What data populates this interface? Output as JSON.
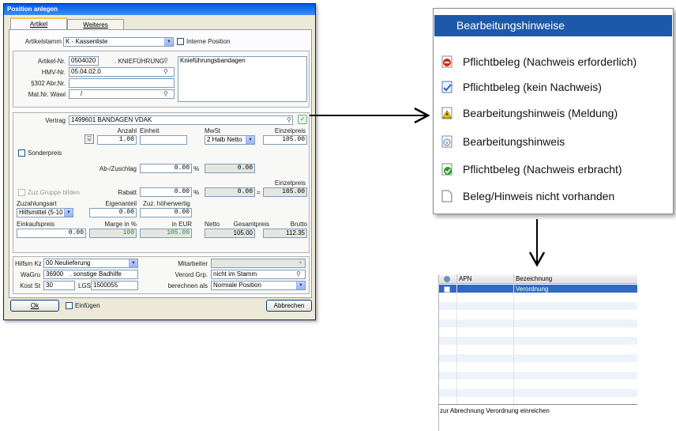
{
  "dialog": {
    "title": "Position anlegen",
    "tabs": [
      {
        "label": "Artikel"
      },
      {
        "label": "Weiteres"
      }
    ],
    "artikelstamm_label": "Artikelstamm",
    "artikelstamm_value": "K - Kassenliste",
    "interne_position_label": "Interne Position",
    "artikel_nr_label": "Artikel-Nr.",
    "artikel_nr_value": "0504020",
    "artikel_kurz_value": ". KNIEFÜHRUNG",
    "hmv_nr_label": "HMV-Nr.",
    "hmv_nr_value": "05.04.02.0",
    "abr_nr_label": "§302 Abr.Nr.",
    "abr_nr_value": "",
    "mat_nr_label": "Mat.Nr. Wawi",
    "mat_nr_value": "/",
    "bezeichnung_text": "Knieführungsbandagen",
    "vertrag_label": "Vertrag",
    "vertrag_value": "1499601 BANDAGEN VDAK",
    "anzahl_label": "Anzahl",
    "anzahl_value": "1.00",
    "einheit_label": "Einheit",
    "einheit_value": "",
    "mwst_label": "MwSt",
    "mwst_value": "2 Halb Netto",
    "einzelpreis_label": "Einzelpreis",
    "einzelpreis_value": "105.00",
    "sonderpreis_label": "Sonderpreis",
    "ab_zuschlag_label": "Ab-/Zuschlag",
    "ab_zuschlag_value": "0.00",
    "ab_zuschlag_result": "0.00",
    "percent": "%",
    "equals": "=",
    "einzelpreis2_label": "Einzelpreis",
    "zuz_gruppe_label": "Zuz.Gruppe bilden",
    "rabatt_label": "Rabatt",
    "rabatt_value": "0.00",
    "rabatt_result": "0.00",
    "einzelpreis2_value": "105.00",
    "zahlungsart_label": "Zuzahlungsart",
    "zahlungsart_value": "Hilfsmittel (5-10",
    "eigenanteil_label": "Eigenanteil",
    "eigenanteil_value": "0.00",
    "zuz_hoeher_label": "Zuz. höherwertig",
    "zuz_hoeher_value": "0.00",
    "einkaufspreis_label": "Einkaufspreis",
    "einkaufspreis_value": "0.00",
    "marge_label": "Marge in %",
    "marge_value": "100",
    "in_eur_label": "in EUR",
    "in_eur_value": "105.00",
    "netto_label": "Netto",
    "netto_value": "105.00",
    "gesamtpreis_label": "Gesamtpreis",
    "brutto_label": "Brutto",
    "brutto_value": "112.35",
    "hilfsm_kz_label": "Hilfsm Kz",
    "hilfsm_kz_value": "00 Neulieferung",
    "mitarbeiter_label": "Mitarbeiter",
    "mitarbeiter_value": "",
    "wagru_label": "WaGru",
    "wagru_value": "36900",
    "wagru_text": ". sonstige Badhilfe",
    "verord_grp_label": "Verord Grp.",
    "verord_grp_value": "nicht im Stamm",
    "kost_st_label": "Kost St",
    "kost_st_value": "30",
    "lgs_label": "LGS",
    "lgs_value": "1500055",
    "berechnen_label": "berechnen als",
    "berechnen_value": "Normale Position",
    "ok_label": "Ok",
    "einfuegen_label": "Einfügen",
    "abbrechen_label": "Abbrechen"
  },
  "menu": {
    "header": "Bearbeitungshinweise",
    "items": [
      {
        "label": "Pflichtbeleg (Nachweis erforderlich)",
        "icon": "red-stop-icon"
      },
      {
        "label": "Pflichtbeleg (kein Nachweis)",
        "icon": "doc-check-blue-icon"
      },
      {
        "label": "Bearbeitungshinweis (Meldung)",
        "icon": "doc-warning-icon"
      },
      {
        "label": "Bearbeitungshinweis",
        "icon": "doc-info-icon"
      },
      {
        "label": "Pflichtbeleg (Nachweis erbracht)",
        "icon": "doc-check-green-icon"
      },
      {
        "label": "Beleg/Hinweis nicht vorhanden",
        "icon": "blank-doc-icon"
      }
    ]
  },
  "grid": {
    "columns": [
      {
        "label": "APN"
      },
      {
        "label": "Bezeichnung"
      }
    ],
    "rows": [
      {
        "apn": "",
        "bezeichnung": "Verordnung"
      }
    ],
    "footer_text": "zur Abrechnung Verordnung einreichen"
  },
  "colors": {
    "menu_header": "#1e58a8",
    "title_bar": "#0058ee",
    "selected_row": "#3169c6",
    "green_value": "#2e8b2e"
  }
}
